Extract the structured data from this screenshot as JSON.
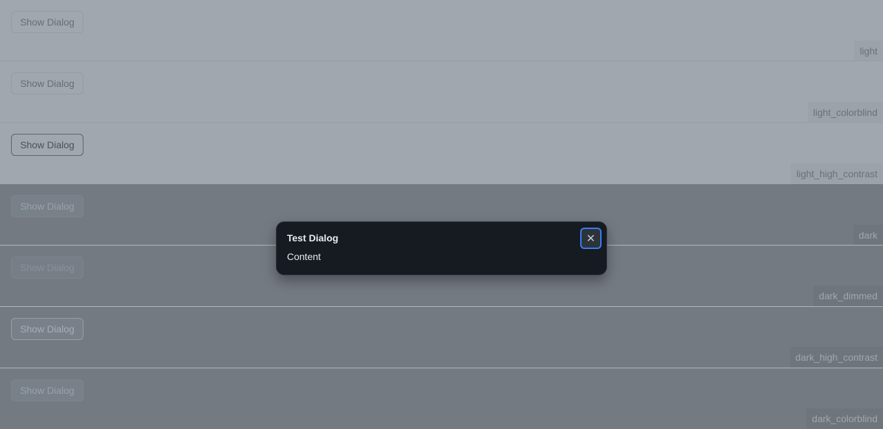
{
  "rows": [
    {
      "button_label": "Show Dialog",
      "theme": "light"
    },
    {
      "button_label": "Show Dialog",
      "theme": "light_colorblind"
    },
    {
      "button_label": "Show Dialog",
      "theme": "light_high_contrast"
    },
    {
      "button_label": "Show Dialog",
      "theme": "dark"
    },
    {
      "button_label": "Show Dialog",
      "theme": "dark_dimmed"
    },
    {
      "button_label": "Show Dialog",
      "theme": "dark_high_contrast"
    },
    {
      "button_label": "Show Dialog",
      "theme": "dark_colorblind"
    }
  ],
  "dialog": {
    "title": "Test Dialog",
    "content": "Content",
    "close_icon": "close-icon",
    "close_glyph": "✕"
  },
  "colors": {
    "light_overlay": "#a1a7ae",
    "dark_overlay": "#747a82",
    "dialog_bg": "#161a21",
    "focus_ring": "#3a7ff0"
  }
}
